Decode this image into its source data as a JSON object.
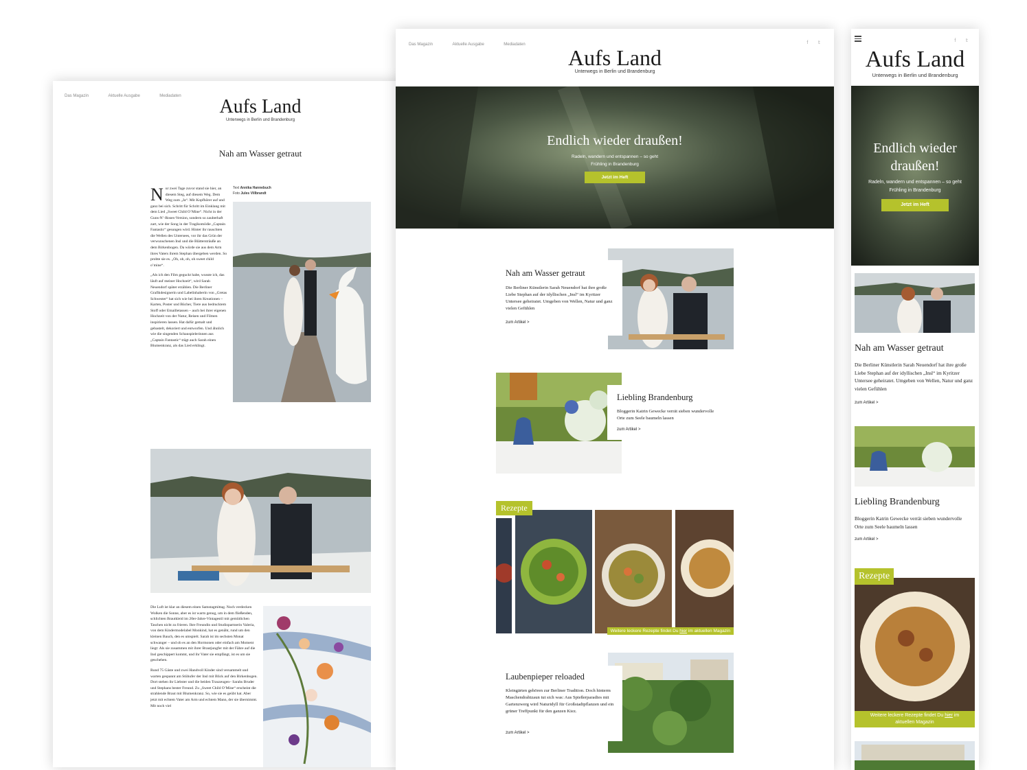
{
  "brand": {
    "logo": "Aufs Land",
    "tagline": "Unterwegs in Berlin und Brandenburg",
    "accent": "#b5c22c"
  },
  "nav": [
    "Das Magazin",
    "Aktuelle Ausgabe",
    "Mediadaten"
  ],
  "social_icons": [
    "facebook-icon",
    "twitter-icon"
  ],
  "article": {
    "title": "Nah am Wasser getraut",
    "credits_text_label": "Text",
    "credits_text_name": "Annika Hannebuch",
    "credits_photo_label": "Foto",
    "credits_photo_name": "Jules Villbrandt",
    "drop_cap": "N",
    "para1": "ur zwei Tage zuvor stand sie hier, an diesem Steg, auf diesem Weg. Dem Weg zum „Ja“. Mit Kopfhörer auf und ganz bei sich. Schritt für Schritt im Einklang mit dem Lied „Sweet Child O’Mine“. Nicht in der Guns-N’-Roses-Version, sondern so zauberhaft zart, wie der Song in der Tragikomödie „Captain Fantastic“ gesungen wird. Hinter ihr rauschten die Wellen des Untersees, vor ihr das Grün der verwunschenen Insl und die Blättersträuße an dem Birkenbogen. Da würde sie aus dem Arm ihres Vaters ihrem Stephan übergeben werden. So probte sie es. „Oh, oh, oh, oh sweet child o’mine“.",
    "para2": "„Als ich den Film geguckt habe, wusste ich, das läuft auf meiner Hochzeit“, wird Sarah Neuendorf später erzählen. Die Berliner Grafikdesignerin und Labelinhaberin von „Gretas Schwester“ hat sich wie bei ihren Kreationen – Karten, Poster und Bücher, Tiere aus bedrucktem Stoff oder Emailletassen – auch bei ihrer eigenen Hochzeit von der Natur, Reisen und Filmen inspirieren lassen. Hat dafür gemalt und gebastelt, dekoriert und entworfen. Und ähnlich wie die singenden Schauspielerinnen aus „Captain Fantastic“ trägt auch Sarah einen Blumenkranz, als das Lied erklingt.",
    "para3": "Die Luft ist klar an diesem einen Samstagmittag. Noch verdecken Wolken die Sonne, aber es ist warm genug, um in dem fließenden, schlichten Brautkleid im 20er-Jahre-Vintagestil mit gemütlichen Taschen nicht zu frieren. Ihre Freundin und Studiopartnerin Valeria, von dem Kindermodelabel Monkind, hat es genäht, rund um den kleinen Bauch, den es umspielt. Sarah ist im sechsten Monat schwanger – und ob es an den Hormonen oder einfach am Moment liegt: Als sie zusammen mit ihrer Brautjungfer mit der Fähre auf die Insl geschippert kommt, und ihr Vater sie empfängt, ist es um sie geschehen.",
    "para4": "Rund 75 Gäste und zwei Handvoll Kinder sind versammelt und warten gespannt am Stühufer der Insl mit Blick auf den Birkenbogen. Dort stehen ihr Liebster und die beiden Trauzeugen– Sarahs Bruder und Stephans bester Freund. Zu „Sweet Child O’Mine“ erscheint die strahlende Braut mit Blumenkranz. So, wie sie es geübt hat. Aber jetzt mit echtem Vater am Arm und echtem Mann, der sie übernimmt. Mit noch viel"
  },
  "hero": {
    "title": "Endlich wieder draußen!",
    "subtitle_line1": "Radeln, wandern und entspannen – so geht",
    "subtitle_line2": "Frühling in Brandenburg",
    "cta": "Jetzt im Heft"
  },
  "cards": [
    {
      "title": "Nah am Wasser getraut",
      "text": "Die Berliner Künstlerin Sarah Neuendorf hat ihre große Liebe Stephan auf der idyllischen „Insl“ im Kyritzer Untersee geheiratet. Umgeben von Wellen, Natur und ganz vielen Gefühlen",
      "more": "zum Artikel >"
    },
    {
      "title": "Liebling Brandenburg",
      "text": "Bloggerin Katrin Gewecke verrät sieben wundervolle Orte zum Seele baumeln lassen",
      "more": "zum Artikel >"
    },
    {
      "title": "Laubenpieper reloaded",
      "text": "Kleingärten gehören zur Berliner Tradition. Doch hinterm Maschendrahtzaun tut sich was: Aus Spießerparadies mit Gartenzwerg wird Naturidyll für Großstadtpflanzen und ein grüner Treffpunkt für den ganzen Kiez.",
      "more": "zum Artikel >"
    }
  ],
  "recipes": {
    "tag": "Rezepte",
    "caption_pre": "Weitere leckere Rezepte findet Du ",
    "caption_link": "hier",
    "caption_post": " im aktuellen Magazin",
    "mobile_caption_line1_pre": "Weitere leckere Rezepte findet Du ",
    "mobile_caption_line2": "aktuellen Magazin",
    "mobile_caption_line1_post": " im"
  },
  "mobile_hero": {
    "title_line1": "Endlich wieder",
    "title_line2": "draußen!",
    "subtitle_line1": "Radeln, wandern und entspannen – so geht",
    "subtitle_line2": "Frühling in Brandenburg"
  }
}
